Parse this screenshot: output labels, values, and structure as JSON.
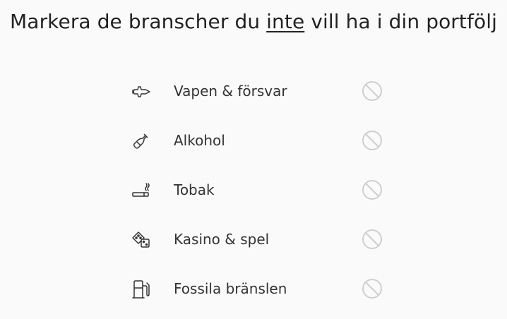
{
  "header": {
    "title_before": "Markera de branscher du ",
    "title_emphasis": "inte",
    "title_after": " vill ha i din portfölj"
  },
  "colors": {
    "text": "#222222",
    "icon": "#333333",
    "toggle": "#cfcfcf",
    "background": "#fafafa"
  },
  "industries": [
    {
      "label": "Vapen & försvar",
      "icon": "fighter-jet-icon",
      "excluded": false
    },
    {
      "label": "Alkohol",
      "icon": "bottle-icon",
      "excluded": false
    },
    {
      "label": "Tobak",
      "icon": "cigarette-icon",
      "excluded": false
    },
    {
      "label": "Kasino & spel",
      "icon": "dice-icon",
      "excluded": false
    },
    {
      "label": "Fossila bränslen",
      "icon": "fuel-pump-icon",
      "excluded": false
    }
  ]
}
